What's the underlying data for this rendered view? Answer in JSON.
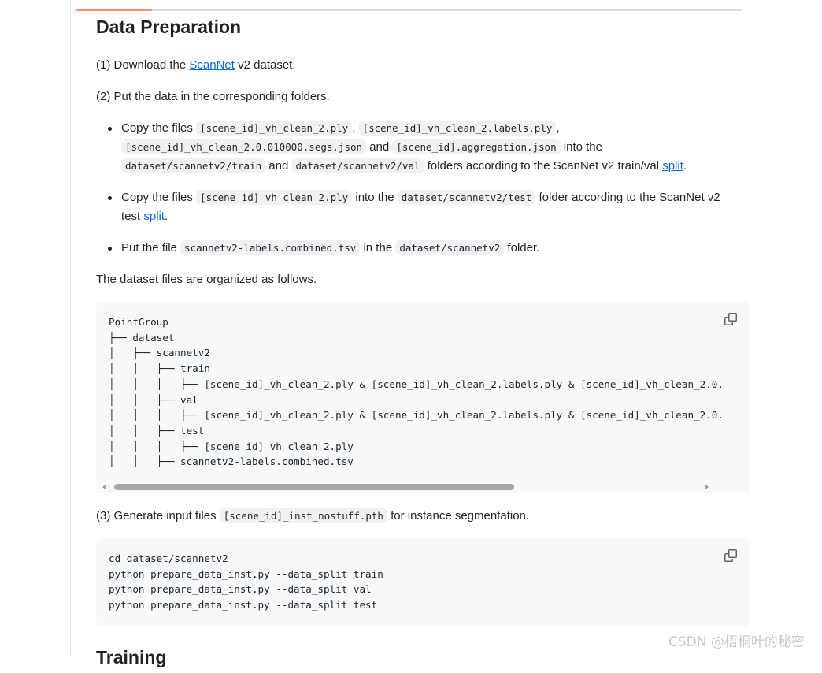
{
  "section": {
    "title": "Data Preparation",
    "next_title": "Training"
  },
  "step1": {
    "prefix": "(1) Download the ",
    "link": "ScanNet",
    "suffix": " v2 dataset."
  },
  "step2": {
    "text": "(2) Put the data in the corresponding folders."
  },
  "bullets": {
    "b1": {
      "t1": "Copy the files ",
      "c1": "[scene_id]_vh_clean_2.ply",
      "t2": ", ",
      "c2": "[scene_id]_vh_clean_2.labels.ply",
      "t3": ",",
      "c3": "[scene_id]_vh_clean_2.0.010000.segs.json",
      "t4": " and ",
      "c4": "[scene_id].aggregation.json",
      "t5": " into the",
      "c5": "dataset/scannetv2/train",
      "t6": " and ",
      "c6": "dataset/scannetv2/val",
      "t7": " folders according to the ScanNet v2 train/val ",
      "link": "split",
      "t8": "."
    },
    "b2": {
      "t1": "Copy the files ",
      "c1": "[scene_id]_vh_clean_2.ply",
      "t2": " into the ",
      "c2": "dataset/scannetv2/test",
      "t3": " folder according to the ScanNet v2",
      "t4": "test ",
      "link": "split",
      "t5": "."
    },
    "b3": {
      "t1": "Put the file ",
      "c1": "scannetv2-labels.combined.tsv",
      "t2": " in the ",
      "c2": "dataset/scannetv2",
      "t3": " folder."
    }
  },
  "organized_text": "The dataset files are organized as follows.",
  "tree_code": "PointGroup\n├── dataset\n│   ├── scannetv2\n│   │   ├── train\n│   │   │   ├── [scene_id]_vh_clean_2.ply & [scene_id]_vh_clean_2.labels.ply & [scene_id]_vh_clean_2.0.\n│   │   ├── val\n│   │   │   ├── [scene_id]_vh_clean_2.ply & [scene_id]_vh_clean_2.labels.ply & [scene_id]_vh_clean_2.0.\n│   │   ├── test\n│   │   │   ├── [scene_id]_vh_clean_2.ply\n│   │   ├── scannetv2-labels.combined.tsv",
  "step3": {
    "prefix": "(3) Generate input files ",
    "code": "[scene_id]_inst_nostuff.pth",
    "suffix": " for instance segmentation."
  },
  "cmd_code": "cd dataset/scannetv2\npython prepare_data_inst.py --data_split train\npython prepare_data_inst.py --data_split val\npython prepare_data_inst.py --data_split test",
  "watermark": "CSDN @梧桐叶的秘密",
  "icons": {
    "copy": "copy-icon",
    "scroll_left": "scroll-left-arrow-icon",
    "scroll_right": "scroll-right-arrow-icon"
  },
  "colors": {
    "link": "#0969da",
    "code_bg": "#f6f8fa",
    "inline_code_bg": "#eff1f3",
    "tab_accent": "#fd8c73"
  }
}
